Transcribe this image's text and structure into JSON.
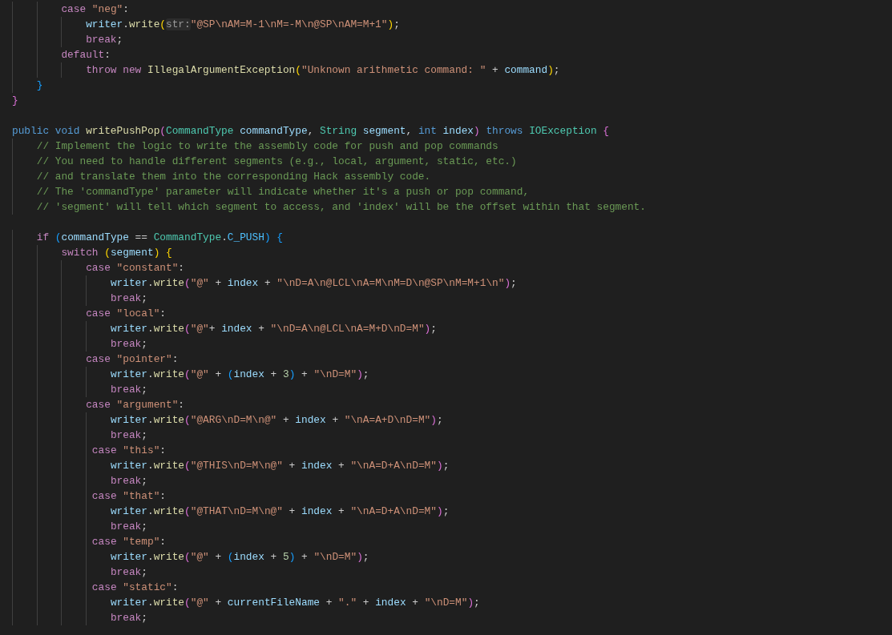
{
  "editor": {
    "lines": [
      {
        "kind": "code",
        "tokens": [
          {
            "kind": "kw",
            "text": "        case "
          },
          {
            "kind": "str",
            "text": "\"neg\""
          },
          {
            "kind": "p",
            "text": ":"
          }
        ]
      },
      {
        "kind": "code",
        "tokens": [
          {
            "kind": "var",
            "text": "            writer"
          },
          {
            "kind": "p",
            "text": "."
          },
          {
            "kind": "fn",
            "text": "write"
          },
          {
            "kind": "b1",
            "text": "("
          },
          {
            "kind": "hint",
            "text": "str:"
          },
          {
            "kind": "str",
            "text": "\"@SP\\nAM=M-1\\nM=-M\\n@SP\\nAM=M+1\""
          },
          {
            "kind": "b1",
            "text": ")"
          },
          {
            "kind": "p",
            "text": ";"
          }
        ]
      },
      {
        "kind": "code",
        "tokens": [
          {
            "kind": "kw",
            "text": "            break"
          },
          {
            "kind": "p",
            "text": ";"
          }
        ]
      },
      {
        "kind": "code",
        "tokens": [
          {
            "kind": "kw",
            "text": "        default"
          },
          {
            "kind": "p",
            "text": ":"
          }
        ]
      },
      {
        "kind": "code",
        "tokens": [
          {
            "kind": "kw",
            "text": "            throw new "
          },
          {
            "kind": "fn",
            "text": "IllegalArgumentException"
          },
          {
            "kind": "b1",
            "text": "("
          },
          {
            "kind": "str",
            "text": "\"Unknown arithmetic command: \""
          },
          {
            "kind": "p",
            "text": " + "
          },
          {
            "kind": "var",
            "text": "command"
          },
          {
            "kind": "b1",
            "text": ")"
          },
          {
            "kind": "p",
            "text": ";"
          }
        ]
      },
      {
        "kind": "code",
        "tokens": [
          {
            "kind": "b3",
            "text": "    }"
          }
        ]
      },
      {
        "kind": "code",
        "tokens": [
          {
            "kind": "b2",
            "text": "}"
          }
        ]
      },
      {
        "kind": "blank"
      },
      {
        "kind": "code",
        "tokens": [
          {
            "kind": "kw2",
            "text": "public void "
          },
          {
            "kind": "fn",
            "text": "writePushPop"
          },
          {
            "kind": "b2",
            "text": "("
          },
          {
            "kind": "type",
            "text": "CommandType "
          },
          {
            "kind": "var",
            "text": "commandType"
          },
          {
            "kind": "p",
            "text": ", "
          },
          {
            "kind": "type",
            "text": "String "
          },
          {
            "kind": "var",
            "text": "segment"
          },
          {
            "kind": "p",
            "text": ", "
          },
          {
            "kind": "kw2",
            "text": "int "
          },
          {
            "kind": "var",
            "text": "index"
          },
          {
            "kind": "b2",
            "text": ")"
          },
          {
            "kind": "kw2",
            "text": " throws "
          },
          {
            "kind": "type",
            "text": "IOException "
          },
          {
            "kind": "b2",
            "text": "{"
          }
        ]
      },
      {
        "kind": "code",
        "tokens": [
          {
            "kind": "com",
            "text": "    // Implement the logic to write the assembly code for push and pop commands"
          }
        ]
      },
      {
        "kind": "code",
        "tokens": [
          {
            "kind": "com",
            "text": "    // You need to handle different segments (e.g., local, argument, static, etc.)"
          }
        ]
      },
      {
        "kind": "code",
        "tokens": [
          {
            "kind": "com",
            "text": "    // and translate them into the corresponding Hack assembly code."
          }
        ]
      },
      {
        "kind": "code",
        "tokens": [
          {
            "kind": "com",
            "text": "    // The 'commandType' parameter will indicate whether it's a push or pop command,"
          }
        ]
      },
      {
        "kind": "code",
        "tokens": [
          {
            "kind": "com",
            "text": "    // 'segment' will tell which segment to access, and 'index' will be the offset within that segment."
          }
        ]
      },
      {
        "kind": "blank"
      },
      {
        "kind": "code",
        "tokens": [
          {
            "kind": "kw",
            "text": "    if "
          },
          {
            "kind": "b3",
            "text": "("
          },
          {
            "kind": "var",
            "text": "commandType"
          },
          {
            "kind": "p",
            "text": " == "
          },
          {
            "kind": "type",
            "text": "CommandType"
          },
          {
            "kind": "p",
            "text": "."
          },
          {
            "kind": "const",
            "text": "C_PUSH"
          },
          {
            "kind": "b3",
            "text": ") {"
          }
        ]
      },
      {
        "kind": "code",
        "tokens": [
          {
            "kind": "kw",
            "text": "        switch "
          },
          {
            "kind": "b1",
            "text": "("
          },
          {
            "kind": "var",
            "text": "segment"
          },
          {
            "kind": "b1",
            "text": ") {"
          }
        ]
      },
      {
        "kind": "code",
        "tokens": [
          {
            "kind": "kw",
            "text": "            case "
          },
          {
            "kind": "str",
            "text": "\"constant\""
          },
          {
            "kind": "p",
            "text": ":"
          }
        ]
      },
      {
        "kind": "code",
        "tokens": [
          {
            "kind": "var",
            "text": "                writer"
          },
          {
            "kind": "p",
            "text": "."
          },
          {
            "kind": "fn",
            "text": "write"
          },
          {
            "kind": "b2",
            "text": "("
          },
          {
            "kind": "str",
            "text": "\"@\""
          },
          {
            "kind": "p",
            "text": " + "
          },
          {
            "kind": "var",
            "text": "index"
          },
          {
            "kind": "p",
            "text": " + "
          },
          {
            "kind": "str",
            "text": "\"\\nD=A\\n@LCL\\nA=M\\nM=D\\n@SP\\nM=M+1\\n\""
          },
          {
            "kind": "b2",
            "text": ")"
          },
          {
            "kind": "p",
            "text": ";"
          }
        ]
      },
      {
        "kind": "code",
        "tokens": [
          {
            "kind": "kw",
            "text": "                break"
          },
          {
            "kind": "p",
            "text": ";"
          }
        ]
      },
      {
        "kind": "code",
        "tokens": [
          {
            "kind": "kw",
            "text": "            case "
          },
          {
            "kind": "str",
            "text": "\"local\""
          },
          {
            "kind": "p",
            "text": ":"
          }
        ]
      },
      {
        "kind": "code",
        "tokens": [
          {
            "kind": "var",
            "text": "                writer"
          },
          {
            "kind": "p",
            "text": "."
          },
          {
            "kind": "fn",
            "text": "write"
          },
          {
            "kind": "b2",
            "text": "("
          },
          {
            "kind": "str",
            "text": "\"@\""
          },
          {
            "kind": "p",
            "text": "+ "
          },
          {
            "kind": "var",
            "text": "index"
          },
          {
            "kind": "p",
            "text": " + "
          },
          {
            "kind": "str",
            "text": "\"\\nD=A\\n@LCL\\nA=M+D\\nD=M\""
          },
          {
            "kind": "b2",
            "text": ")"
          },
          {
            "kind": "p",
            "text": ";"
          }
        ]
      },
      {
        "kind": "code",
        "tokens": [
          {
            "kind": "kw",
            "text": "                break"
          },
          {
            "kind": "p",
            "text": ";"
          }
        ]
      },
      {
        "kind": "code",
        "tokens": [
          {
            "kind": "kw",
            "text": "            case "
          },
          {
            "kind": "str",
            "text": "\"pointer\""
          },
          {
            "kind": "p",
            "text": ":"
          }
        ]
      },
      {
        "kind": "code",
        "tokens": [
          {
            "kind": "var",
            "text": "                writer"
          },
          {
            "kind": "p",
            "text": "."
          },
          {
            "kind": "fn",
            "text": "write"
          },
          {
            "kind": "b2",
            "text": "("
          },
          {
            "kind": "str",
            "text": "\"@\""
          },
          {
            "kind": "p",
            "text": " + "
          },
          {
            "kind": "b3",
            "text": "("
          },
          {
            "kind": "var",
            "text": "index"
          },
          {
            "kind": "p",
            "text": " + "
          },
          {
            "kind": "num",
            "text": "3"
          },
          {
            "kind": "b3",
            "text": ")"
          },
          {
            "kind": "p",
            "text": " + "
          },
          {
            "kind": "str",
            "text": "\"\\nD=M\""
          },
          {
            "kind": "b2",
            "text": ")"
          },
          {
            "kind": "p",
            "text": ";"
          }
        ]
      },
      {
        "kind": "code",
        "tokens": [
          {
            "kind": "kw",
            "text": "                break"
          },
          {
            "kind": "p",
            "text": ";"
          }
        ]
      },
      {
        "kind": "code",
        "tokens": [
          {
            "kind": "kw",
            "text": "            case "
          },
          {
            "kind": "str",
            "text": "\"argument\""
          },
          {
            "kind": "p",
            "text": ":"
          }
        ]
      },
      {
        "kind": "code",
        "tokens": [
          {
            "kind": "var",
            "text": "                writer"
          },
          {
            "kind": "p",
            "text": "."
          },
          {
            "kind": "fn",
            "text": "write"
          },
          {
            "kind": "b2",
            "text": "("
          },
          {
            "kind": "str",
            "text": "\"@ARG\\nD=M\\n@\""
          },
          {
            "kind": "p",
            "text": " + "
          },
          {
            "kind": "var",
            "text": "index"
          },
          {
            "kind": "p",
            "text": " + "
          },
          {
            "kind": "str",
            "text": "\"\\nA=A+D\\nD=M\""
          },
          {
            "kind": "b2",
            "text": ")"
          },
          {
            "kind": "p",
            "text": ";"
          }
        ]
      },
      {
        "kind": "code",
        "tokens": [
          {
            "kind": "kw",
            "text": "                break"
          },
          {
            "kind": "p",
            "text": ";"
          }
        ]
      },
      {
        "kind": "code",
        "tokens": [
          {
            "kind": "kw",
            "text": "             case "
          },
          {
            "kind": "str",
            "text": "\"this\""
          },
          {
            "kind": "p",
            "text": ":"
          }
        ]
      },
      {
        "kind": "code",
        "tokens": [
          {
            "kind": "var",
            "text": "                writer"
          },
          {
            "kind": "p",
            "text": "."
          },
          {
            "kind": "fn",
            "text": "write"
          },
          {
            "kind": "b2",
            "text": "("
          },
          {
            "kind": "str",
            "text": "\"@THIS\\nD=M\\n@\""
          },
          {
            "kind": "p",
            "text": " + "
          },
          {
            "kind": "var",
            "text": "index"
          },
          {
            "kind": "p",
            "text": " + "
          },
          {
            "kind": "str",
            "text": "\"\\nA=D+A\\nD=M\""
          },
          {
            "kind": "b2",
            "text": ")"
          },
          {
            "kind": "p",
            "text": ";"
          }
        ]
      },
      {
        "kind": "code",
        "tokens": [
          {
            "kind": "kw",
            "text": "                break"
          },
          {
            "kind": "p",
            "text": ";"
          }
        ]
      },
      {
        "kind": "code",
        "tokens": [
          {
            "kind": "kw",
            "text": "             case "
          },
          {
            "kind": "str",
            "text": "\"that\""
          },
          {
            "kind": "p",
            "text": ":"
          }
        ]
      },
      {
        "kind": "code",
        "tokens": [
          {
            "kind": "var",
            "text": "                writer"
          },
          {
            "kind": "p",
            "text": "."
          },
          {
            "kind": "fn",
            "text": "write"
          },
          {
            "kind": "b2",
            "text": "("
          },
          {
            "kind": "str",
            "text": "\"@THAT\\nD=M\\n@\""
          },
          {
            "kind": "p",
            "text": " + "
          },
          {
            "kind": "var",
            "text": "index"
          },
          {
            "kind": "p",
            "text": " + "
          },
          {
            "kind": "str",
            "text": "\"\\nA=D+A\\nD=M\""
          },
          {
            "kind": "b2",
            "text": ")"
          },
          {
            "kind": "p",
            "text": ";"
          }
        ]
      },
      {
        "kind": "code",
        "tokens": [
          {
            "kind": "kw",
            "text": "                break"
          },
          {
            "kind": "p",
            "text": ";"
          }
        ]
      },
      {
        "kind": "code",
        "tokens": [
          {
            "kind": "kw",
            "text": "             case "
          },
          {
            "kind": "str",
            "text": "\"temp\""
          },
          {
            "kind": "p",
            "text": ":"
          }
        ]
      },
      {
        "kind": "code",
        "tokens": [
          {
            "kind": "var",
            "text": "                writer"
          },
          {
            "kind": "p",
            "text": "."
          },
          {
            "kind": "fn",
            "text": "write"
          },
          {
            "kind": "b2",
            "text": "("
          },
          {
            "kind": "str",
            "text": "\"@\""
          },
          {
            "kind": "p",
            "text": " + "
          },
          {
            "kind": "b3",
            "text": "("
          },
          {
            "kind": "var",
            "text": "index"
          },
          {
            "kind": "p",
            "text": " + "
          },
          {
            "kind": "num",
            "text": "5"
          },
          {
            "kind": "b3",
            "text": ")"
          },
          {
            "kind": "p",
            "text": " + "
          },
          {
            "kind": "str",
            "text": "\"\\nD=M\""
          },
          {
            "kind": "b2",
            "text": ")"
          },
          {
            "kind": "p",
            "text": ";"
          }
        ]
      },
      {
        "kind": "code",
        "tokens": [
          {
            "kind": "kw",
            "text": "                break"
          },
          {
            "kind": "p",
            "text": ";"
          }
        ]
      },
      {
        "kind": "code",
        "tokens": [
          {
            "kind": "kw",
            "text": "             case "
          },
          {
            "kind": "str",
            "text": "\"static\""
          },
          {
            "kind": "p",
            "text": ":"
          }
        ]
      },
      {
        "kind": "code",
        "tokens": [
          {
            "kind": "var",
            "text": "                writer"
          },
          {
            "kind": "p",
            "text": "."
          },
          {
            "kind": "fn",
            "text": "write"
          },
          {
            "kind": "b2",
            "text": "("
          },
          {
            "kind": "str",
            "text": "\"@\""
          },
          {
            "kind": "p",
            "text": " + "
          },
          {
            "kind": "var",
            "text": "currentFileName"
          },
          {
            "kind": "p",
            "text": " + "
          },
          {
            "kind": "str",
            "text": "\".\""
          },
          {
            "kind": "p",
            "text": " + "
          },
          {
            "kind": "var",
            "text": "index"
          },
          {
            "kind": "p",
            "text": " + "
          },
          {
            "kind": "str",
            "text": "\"\\nD=M\""
          },
          {
            "kind": "b2",
            "text": ")"
          },
          {
            "kind": "p",
            "text": ";"
          }
        ]
      },
      {
        "kind": "code",
        "tokens": [
          {
            "kind": "kw",
            "text": "                break"
          },
          {
            "kind": "p",
            "text": ";"
          }
        ]
      }
    ]
  }
}
